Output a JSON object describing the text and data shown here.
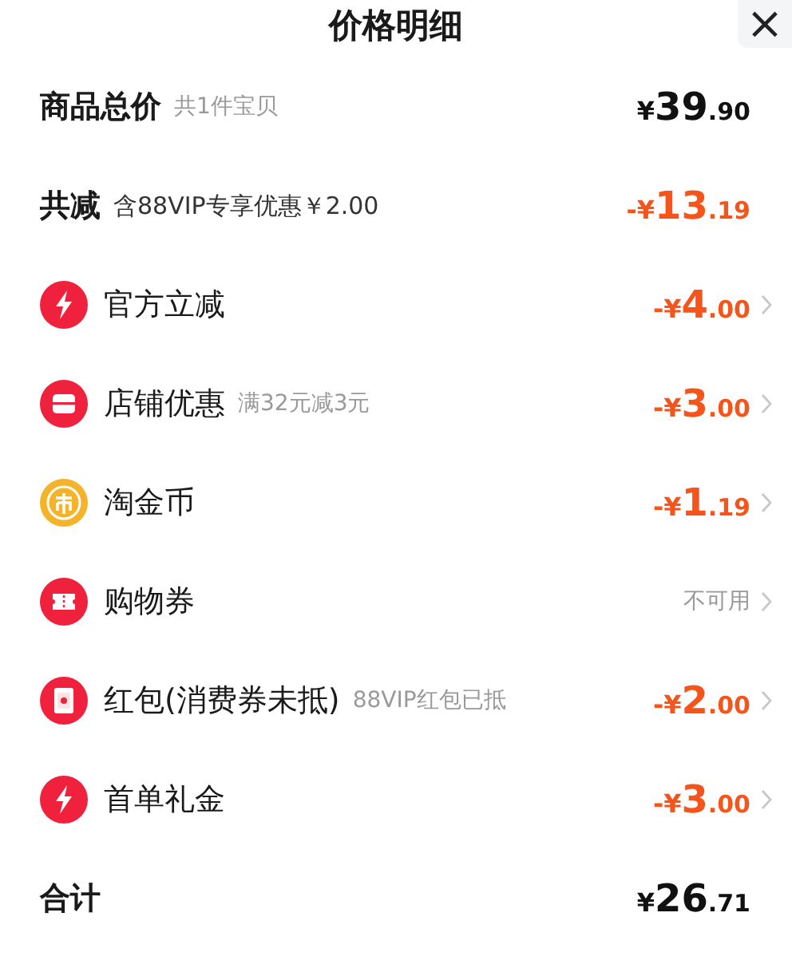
{
  "title": "价格明细",
  "close": "×",
  "rows": [
    {
      "kind": "total",
      "label": "商品总价",
      "note": "共1件宝贝",
      "amount": {
        "currency": "¥",
        "integer": "39",
        "decimals": ".90"
      }
    },
    {
      "kind": "reduction",
      "label": "共减",
      "note": "含88VIP专享优惠￥2.00",
      "amount": {
        "currency": "-¥",
        "integer": "13",
        "decimals": ".19"
      }
    },
    {
      "kind": "item",
      "label": "官方立减",
      "amount": {
        "currency": "-¥",
        "integer": "4",
        "decimals": ".00"
      }
    },
    {
      "kind": "item",
      "label": "店铺优惠",
      "note": "满32元减3元",
      "amount": {
        "currency": "-¥",
        "integer": "3",
        "decimals": ".00"
      }
    },
    {
      "kind": "item",
      "label": "淘金币",
      "amount": {
        "currency": "-¥",
        "integer": "1",
        "decimals": ".19"
      }
    },
    {
      "kind": "item",
      "label": "购物券",
      "status": "不可用"
    },
    {
      "kind": "item",
      "label": "红包(消费券未抵)",
      "note": "88VIP红包已抵",
      "amount": {
        "currency": "-¥",
        "integer": "2",
        "decimals": ".00"
      }
    },
    {
      "kind": "item",
      "label": "首单礼金",
      "amount": {
        "currency": "-¥",
        "integer": "3",
        "decimals": ".00"
      }
    },
    {
      "kind": "total",
      "label": "合计",
      "amount": {
        "currency": "¥",
        "integer": "26",
        "decimals": ".71"
      }
    }
  ]
}
